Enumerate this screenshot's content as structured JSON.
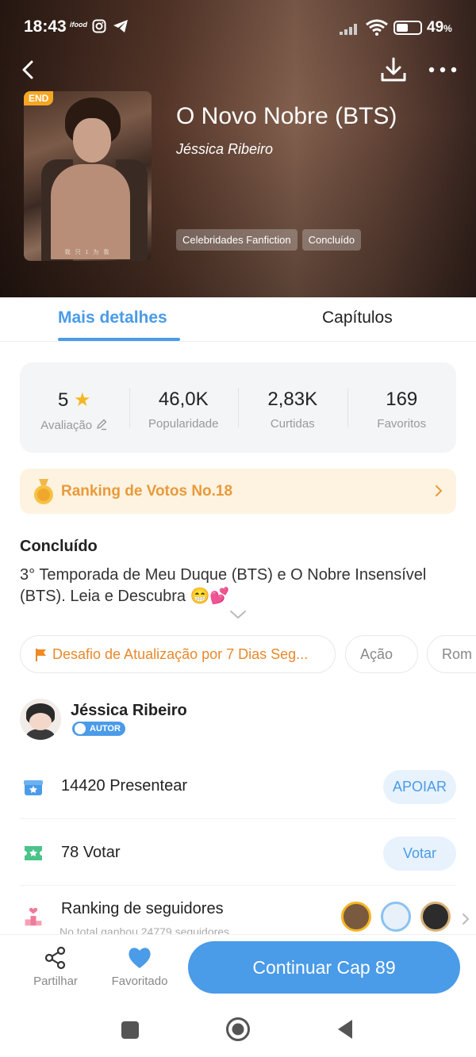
{
  "status_bar": {
    "time": "18:43",
    "ifood": "ifood",
    "battery": "49",
    "battery_unit": "%"
  },
  "book": {
    "title": "O Novo Nobre (BTS)",
    "author": "Jéssica Ribeiro",
    "end_badge": "END",
    "cover_caption": "我 只 1 为 我",
    "tags": [
      "Celebridades Fanfiction",
      "Concluído"
    ]
  },
  "tabs": {
    "details": "Mais detalhes",
    "chapters": "Capítulos"
  },
  "stats": [
    {
      "value": "5",
      "label": "Avaliação"
    },
    {
      "value": "46,0K",
      "label": "Popularidade"
    },
    {
      "value": "2,83K",
      "label": "Curtidas"
    },
    {
      "value": "169",
      "label": "Favoritos"
    }
  ],
  "ranking": {
    "text": "Ranking de Votos No.18"
  },
  "status_label": "Concluído",
  "description": "3° Temporada de Meu Duque (BTS) e O Nobre Insensível (BTS). Leia e Descubra 😁💕",
  "chips": [
    "Desafio de Atualização por 7 Dias Seg...",
    "Ação",
    "Rom"
  ],
  "author_section": {
    "name": "Jéssica Ribeiro",
    "badge": "AUTOR"
  },
  "rows": {
    "gift_count": "14420",
    "gift_label": "Presentear",
    "gift_button": "APOIAR",
    "vote_count": "78",
    "vote_label": "Votar",
    "vote_button": "Votar",
    "followers_title": "Ranking de seguidores",
    "followers_sub": "No total ganhou 24779 seguidores"
  },
  "bottom": {
    "share": "Partilhar",
    "favorited": "Favoritado",
    "continue": "Continuar Cap 89"
  },
  "colors": {
    "accent": "#4a9be8",
    "ranking_bg": "#fdf3e0",
    "ranking_text": "#e89a3c",
    "star": "#f5b623"
  }
}
